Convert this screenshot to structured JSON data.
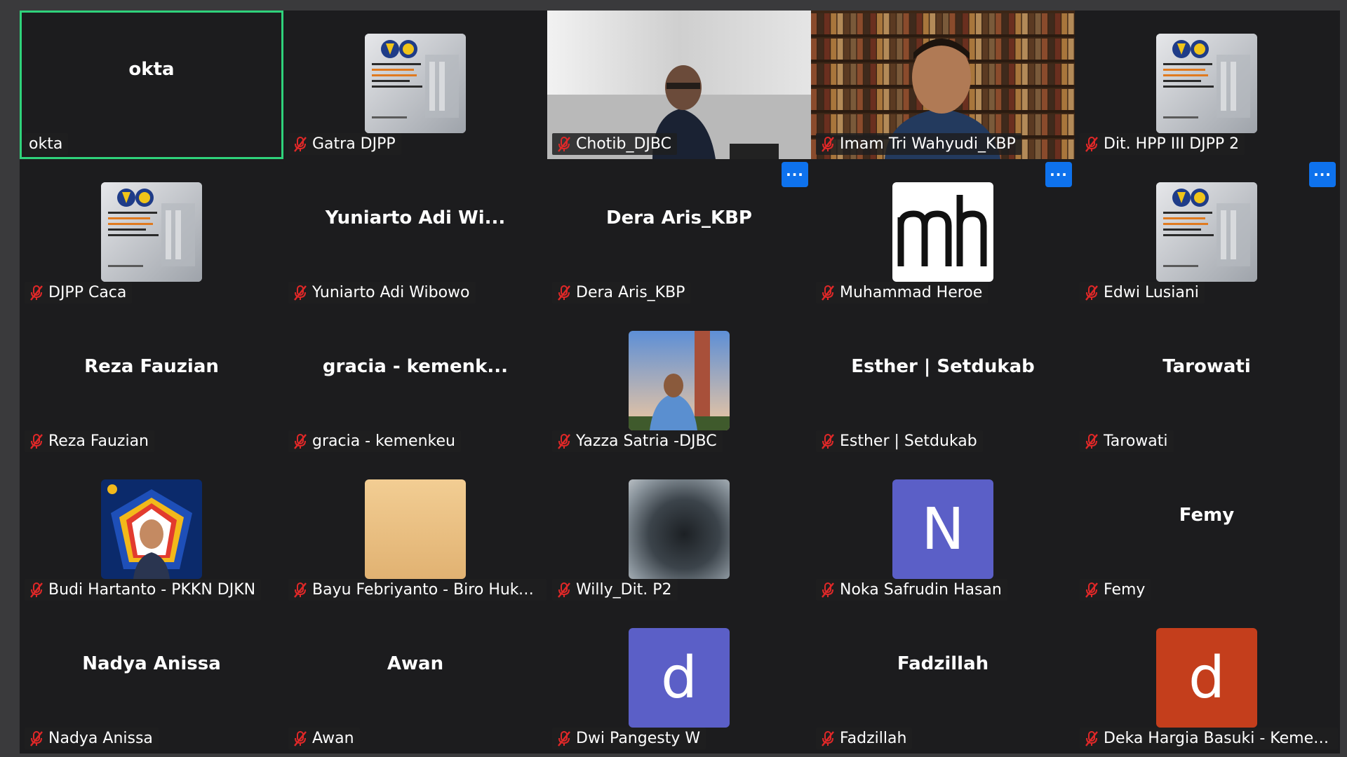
{
  "participants": [
    {
      "display": "okta",
      "label": "okta",
      "muted": false,
      "active": true
    },
    {
      "label": "Gatra DJPP",
      "muted": true,
      "avatar_type": "djpp-logo"
    },
    {
      "label": "Chotib_DJBC",
      "muted": true,
      "avatar_type": "video"
    },
    {
      "label": "Imam Tri Wahyudi_KBP",
      "muted": true,
      "avatar_type": "video-bookshelf"
    },
    {
      "label": "Dit. HPP III DJPP 2",
      "muted": true,
      "avatar_type": "djpp-logo"
    },
    {
      "label": "DJPP Caca",
      "muted": true,
      "avatar_type": "djpp-logo"
    },
    {
      "display": "Yuniarto  Adi  Wi...",
      "label": "Yuniarto Adi Wibowo",
      "muted": true
    },
    {
      "display": "Dera Aris_KBP",
      "label": "Dera Aris_KBP",
      "muted": true,
      "more_button": "···"
    },
    {
      "label": "Muhammad Heroe",
      "muted": true,
      "avatar_type": "mh-logo",
      "avatar_text": "mh",
      "more_button": "···"
    },
    {
      "label": "Edwi Lusiani",
      "muted": true,
      "avatar_type": "djpp-logo",
      "more_button": "···"
    },
    {
      "display": "Reza Fauzian",
      "label": "Reza Fauzian",
      "muted": true
    },
    {
      "display": "gracia  -  kemenk...",
      "label": "gracia - kemenkeu",
      "muted": true
    },
    {
      "label": "Yazza Satria -DJBC",
      "muted": true,
      "avatar_type": "photo-tower"
    },
    {
      "display": "Esther | Setdukab",
      "label": "Esther | Setdukab",
      "muted": true
    },
    {
      "display": "Tarowati",
      "label": "Tarowati",
      "muted": true
    },
    {
      "label": "Budi Hartanto - PKKN DJKN",
      "muted": true,
      "avatar_type": "photo-badge"
    },
    {
      "label": "Bayu Febriyanto - Biro Hukum",
      "muted": true,
      "avatar_type": "beige"
    },
    {
      "label": "Willy_Dit. P2",
      "muted": true,
      "avatar_type": "blurred"
    },
    {
      "label": "Noka Safrudin Hasan",
      "muted": true,
      "avatar_type": "letter",
      "avatar_text": "N",
      "color": "#5b5fc7"
    },
    {
      "display": "Femy",
      "label": "Femy",
      "muted": true
    },
    {
      "display": "Nadya Anissa",
      "label": "Nadya Anissa",
      "muted": true
    },
    {
      "display": "Awan",
      "label": "Awan",
      "muted": true
    },
    {
      "label": "Dwi Pangesty W",
      "muted": true,
      "avatar_type": "letter",
      "avatar_text": "d",
      "color": "#5b5fc7"
    },
    {
      "display": "Fadzillah",
      "label": "Fadzillah",
      "muted": true
    },
    {
      "label": "Deka Hargia Basuki - Kemenk...",
      "muted": true,
      "avatar_type": "letter",
      "avatar_text": "d",
      "color": "#c43e1c"
    }
  ],
  "colors": {
    "background": "#1c1c1e",
    "active_speaker_border": "#2fd27b",
    "more_button": "#0e72ed",
    "muted_icon": "#e02828"
  }
}
